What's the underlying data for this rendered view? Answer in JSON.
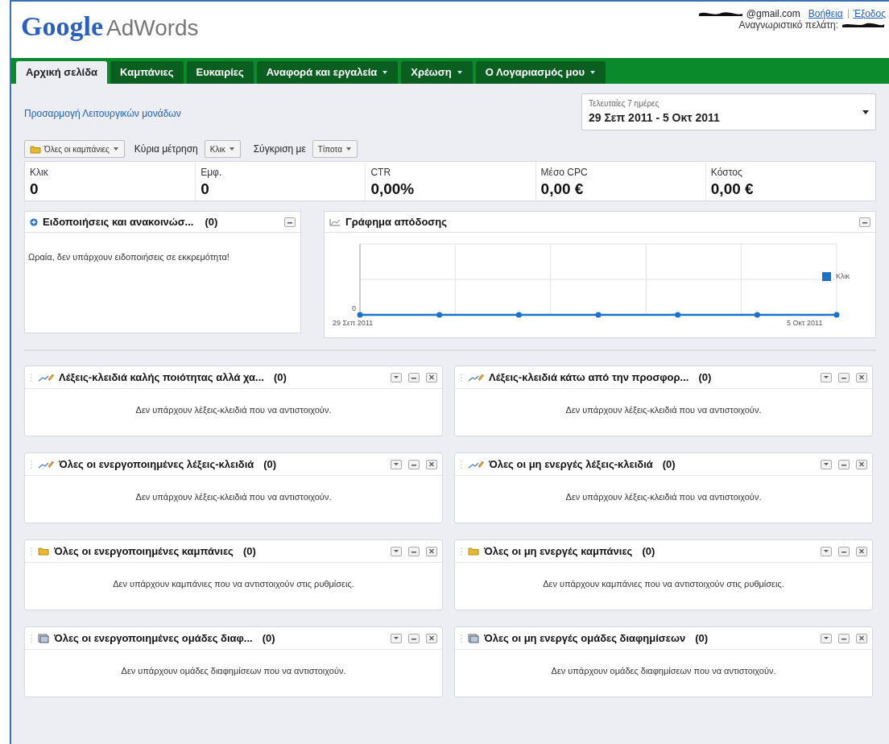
{
  "header": {
    "logo_google": "Google",
    "logo_product": "AdWords",
    "account_email": "@gmail.com",
    "help_link": "Βοήθεια",
    "logout_link": "Έξοδος",
    "customer_id_label": "Αναγνωριστικό πελάτη:"
  },
  "tabs": [
    {
      "label": "Αρχική σελίδα",
      "selected": true,
      "dropdown": false
    },
    {
      "label": "Καμπάνιες",
      "selected": false,
      "dropdown": false
    },
    {
      "label": "Ευκαιρίες",
      "selected": false,
      "dropdown": false
    },
    {
      "label": "Αναφορά και εργαλεία",
      "selected": false,
      "dropdown": true
    },
    {
      "label": "Χρέωση",
      "selected": false,
      "dropdown": true
    },
    {
      "label": "Ο Λογαριασμός μου",
      "selected": false,
      "dropdown": true
    }
  ],
  "customize_link": "Προσαρμογή Λειτουργικών μονάδων",
  "date_range": {
    "caption": "Τελευταίες 7 ημέρες",
    "value": "29 Σεπ 2011 - 5 Οκτ 2011"
  },
  "filters": {
    "campaigns": "Όλες οι καμπάνιες",
    "metric_label": "Κύρια μέτρηση",
    "metric": "Κλικ",
    "compare_label": "Σύγκριση με",
    "compare": "Τίποτα"
  },
  "stats": [
    {
      "label": "Κλικ",
      "value": "0"
    },
    {
      "label": "Εμφ.",
      "value": "0"
    },
    {
      "label": "CTR",
      "value": "0,00%"
    },
    {
      "label": "Μέσο CPC",
      "value": "0,00 €"
    },
    {
      "label": "Κόστος",
      "value": "0,00 €"
    }
  ],
  "notifications": {
    "title": "Ειδοποιήσεις και ανακοινώσ...",
    "count": "(0)",
    "message": "Ωραία, δεν υπάρχουν ειδοποιήσεις σε εκκρεμότητα!"
  },
  "performance_chart": {
    "title": "Γράφημα απόδοσης",
    "y_tick": "0",
    "x_start": "29 Σεπ 2011",
    "x_end": "5 Οκτ 2011",
    "legend": "Κλικ",
    "color": "#1a73c8"
  },
  "widgets": [
    {
      "kind": "keyword",
      "title": "Λέξεις-κλειδιά καλής ποιότητας αλλά χα...",
      "count": "(0)",
      "message": "Δεν υπάρχουν λέξεις-κλειδιά που να αντιστοιχούν."
    },
    {
      "kind": "keyword",
      "title": "Λέξεις-κλειδιά κάτω από την προσφορ...",
      "count": "(0)",
      "message": "Δεν υπάρχουν λέξεις-κλειδιά που να αντιστοιχούν."
    },
    {
      "kind": "keyword",
      "title": "Όλες οι ενεργοποιημένες λέξεις-κλειδιά",
      "count": "(0)",
      "message": "Δεν υπάρχουν λέξεις-κλειδιά που να αντιστοιχούν."
    },
    {
      "kind": "keyword",
      "title": "Όλες οι μη ενεργές λέξεις-κλειδιά",
      "count": "(0)",
      "message": "Δεν υπάρχουν λέξεις-κλειδιά που να αντιστοιχούν."
    },
    {
      "kind": "campaign",
      "title": "Όλες οι ενεργοποιημένες καμπάνιες",
      "count": "(0)",
      "message": "Δεν υπάρχουν καμπάνιες που να αντιστοιχούν στις ρυθμίσεις."
    },
    {
      "kind": "campaign",
      "title": "Όλες οι μη ενεργές καμπάνιες",
      "count": "(0)",
      "message": "Δεν υπάρχουν καμπάνιες που να αντιστοιχούν στις ρυθμίσεις."
    },
    {
      "kind": "adgroup",
      "title": "Όλες οι ενεργοποιημένες ομάδες διαφ...",
      "count": "(0)",
      "message": "Δεν υπάρχουν ομάδες διαφημίσεων που να αντιστοιχούν."
    },
    {
      "kind": "adgroup",
      "title": "Όλες οι μη ενεργές ομάδες διαφημίσεων",
      "count": "(0)",
      "message": "Δεν υπάρχουν ομάδες διαφημίσεων που να αντιστοιχούν."
    }
  ]
}
